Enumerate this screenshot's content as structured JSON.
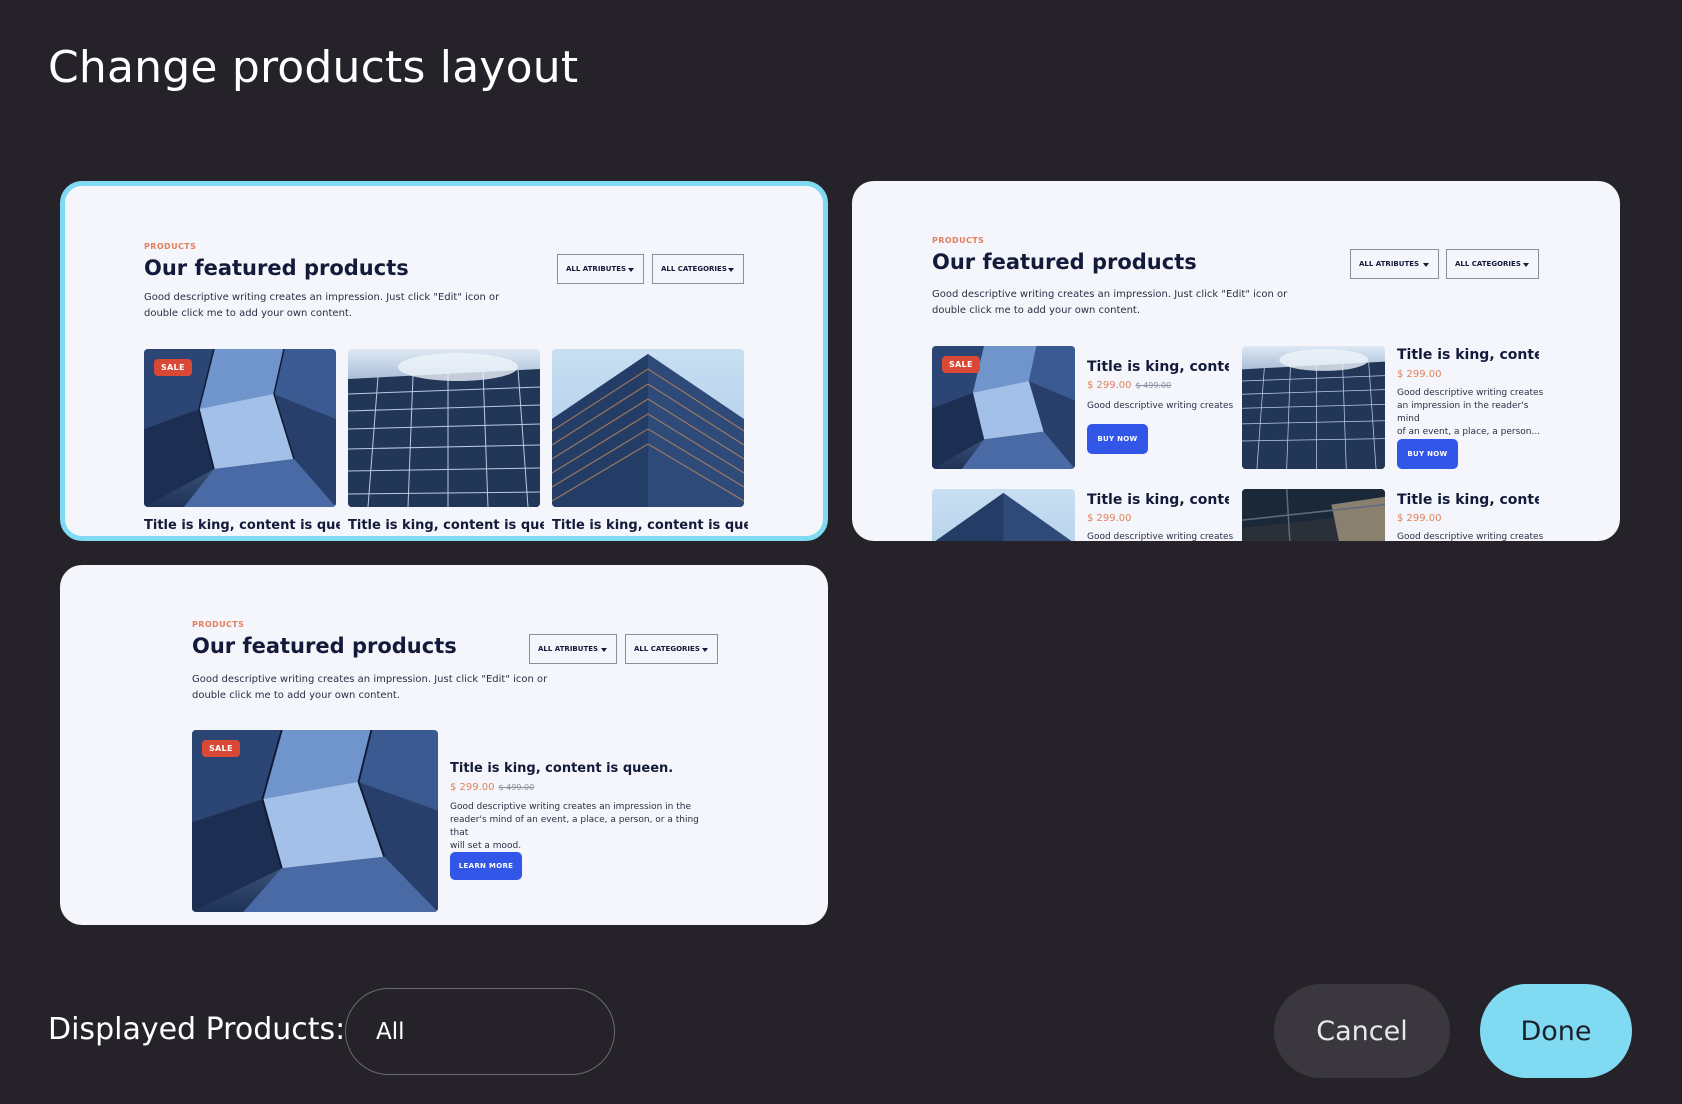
{
  "page": {
    "title": "Change products layout"
  },
  "preview": {
    "eyebrow": "PRODUCTS",
    "heading": "Our featured products",
    "description_line1": "Good descriptive writing creates an impression. Just click \"Edit\" icon or",
    "description_line2": "double click me to add your own content.",
    "filter_attributes": "ALL ATRIBUTES",
    "filter_categories": "ALL CATEGORIES",
    "sale_badge": "SALE"
  },
  "layout_grid": {
    "items": [
      {
        "title": "Title is king, content is queen"
      },
      {
        "title": "Title is king, content is queen"
      },
      {
        "title": "Title is king, content is queen"
      }
    ]
  },
  "layout_list": {
    "items": [
      {
        "title": "Title is king, content...",
        "price": "$ 299.00",
        "old_price": "$ 499.00",
        "desc": "Good descriptive writing creates",
        "button": "BUY NOW"
      },
      {
        "title": "Title is king, content...",
        "price": "$ 299.00",
        "desc_line1": "Good descriptive writing creates",
        "desc_line2": "an impression in the reader's mind",
        "desc_line3": "of an event, a place, a person...",
        "button": "BUY NOW"
      },
      {
        "title": "Title is king, content...",
        "price": "$ 299.00",
        "desc": "Good descriptive writing creates"
      },
      {
        "title": "Title is king, content...",
        "price": "$ 299.00",
        "desc": "Good descriptive writing creates"
      }
    ]
  },
  "layout_single": {
    "title": "Title is king, content is queen.",
    "price": "$ 299.00",
    "old_price": "$ 499.00",
    "desc_line1": "Good descriptive writing creates an impression in the",
    "desc_line2": "reader's mind of an event, a place, a person, or a thing that",
    "desc_line3": "will set a mood.",
    "button": "LEARN MORE"
  },
  "footer": {
    "displayed_label": "Displayed Products:",
    "displayed_value": "All",
    "cancel_label": "Cancel",
    "done_label": "Done"
  },
  "colors": {
    "background": "#252329",
    "accent": "#80dbf2",
    "card": "#f5f6fb",
    "sale": "#d94835",
    "button_blue": "#3256e8",
    "price": "#e0805f"
  }
}
